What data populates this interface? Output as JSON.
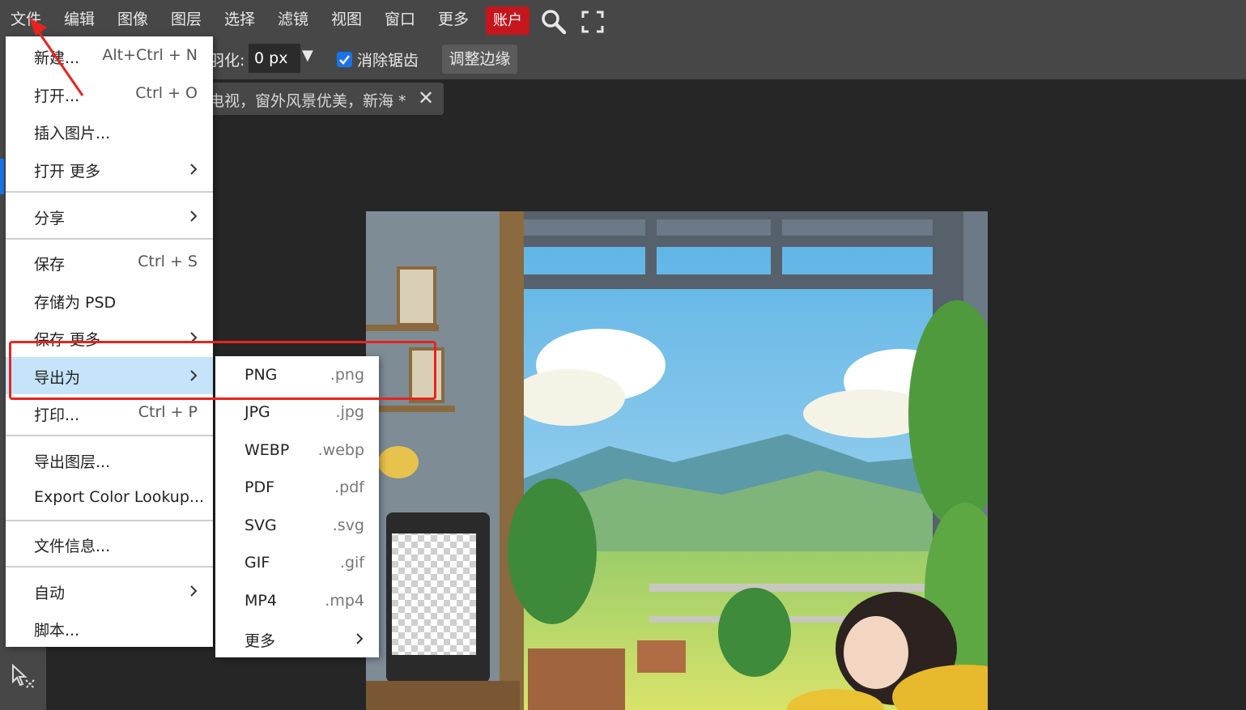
{
  "menubar": {
    "items": [
      {
        "label": "文件",
        "name": "menu-file"
      },
      {
        "label": "编辑",
        "name": "menu-edit"
      },
      {
        "label": "图像",
        "name": "menu-image"
      },
      {
        "label": "图层",
        "name": "menu-layer"
      },
      {
        "label": "选择",
        "name": "menu-select"
      },
      {
        "label": "滤镜",
        "name": "menu-filter"
      },
      {
        "label": "视图",
        "name": "menu-view"
      },
      {
        "label": "窗口",
        "name": "menu-window"
      },
      {
        "label": "更多",
        "name": "menu-more"
      }
    ],
    "account_label": "账户",
    "search_icon": "search-icon",
    "fullscreen_icon": "fullscreen-icon",
    "account_color": "#c4161c"
  },
  "options": {
    "feather_label": "羽化:",
    "feather_value": "0 px",
    "dropdown_glyph": "▼",
    "antialias_label": "消除锯齿",
    "antialias_checked": true,
    "refine_edge_label": "调整边缘"
  },
  "document": {
    "tab_title": "电视，窗外风景优美，新海 *",
    "close_glyph": "✕"
  },
  "file_menu": {
    "items": [
      {
        "label": "新建...",
        "shortcut": "Alt+Ctrl + N"
      },
      {
        "label": "打开...",
        "shortcut": "Ctrl + O"
      },
      {
        "label": "插入图片...",
        "shortcut": ""
      },
      {
        "label": "打开 更多",
        "shortcut": "",
        "submenu": true
      },
      {
        "label": "分享",
        "shortcut": "",
        "submenu": true
      },
      {
        "label": "保存",
        "shortcut": "Ctrl + S"
      },
      {
        "label": "存储为 PSD",
        "shortcut": ""
      },
      {
        "label": "保存 更多",
        "shortcut": "",
        "submenu": true
      },
      {
        "label": "导出为",
        "shortcut": "",
        "submenu": true,
        "highlighted": true
      },
      {
        "label": "打印...",
        "shortcut": "Ctrl + P"
      },
      {
        "label": "导出图层...",
        "shortcut": ""
      },
      {
        "label": "Export Color Lookup...",
        "shortcut": ""
      },
      {
        "label": "文件信息...",
        "shortcut": ""
      },
      {
        "label": "自动",
        "shortcut": "",
        "submenu": true
      },
      {
        "label": "脚本...",
        "shortcut": ""
      }
    ],
    "highlight_color": "#c5e4f9"
  },
  "export_menu": {
    "items": [
      {
        "label": "PNG",
        "ext": ".png"
      },
      {
        "label": "JPG",
        "ext": ".jpg"
      },
      {
        "label": "WEBP",
        "ext": ".webp"
      },
      {
        "label": "PDF",
        "ext": ".pdf"
      },
      {
        "label": "SVG",
        "ext": ".svg"
      },
      {
        "label": "GIF",
        "ext": ".gif"
      },
      {
        "label": "MP4",
        "ext": ".mp4"
      },
      {
        "label": "更多",
        "ext": "",
        "submenu": true
      }
    ]
  },
  "annotation": {
    "color": "#e8231e"
  }
}
